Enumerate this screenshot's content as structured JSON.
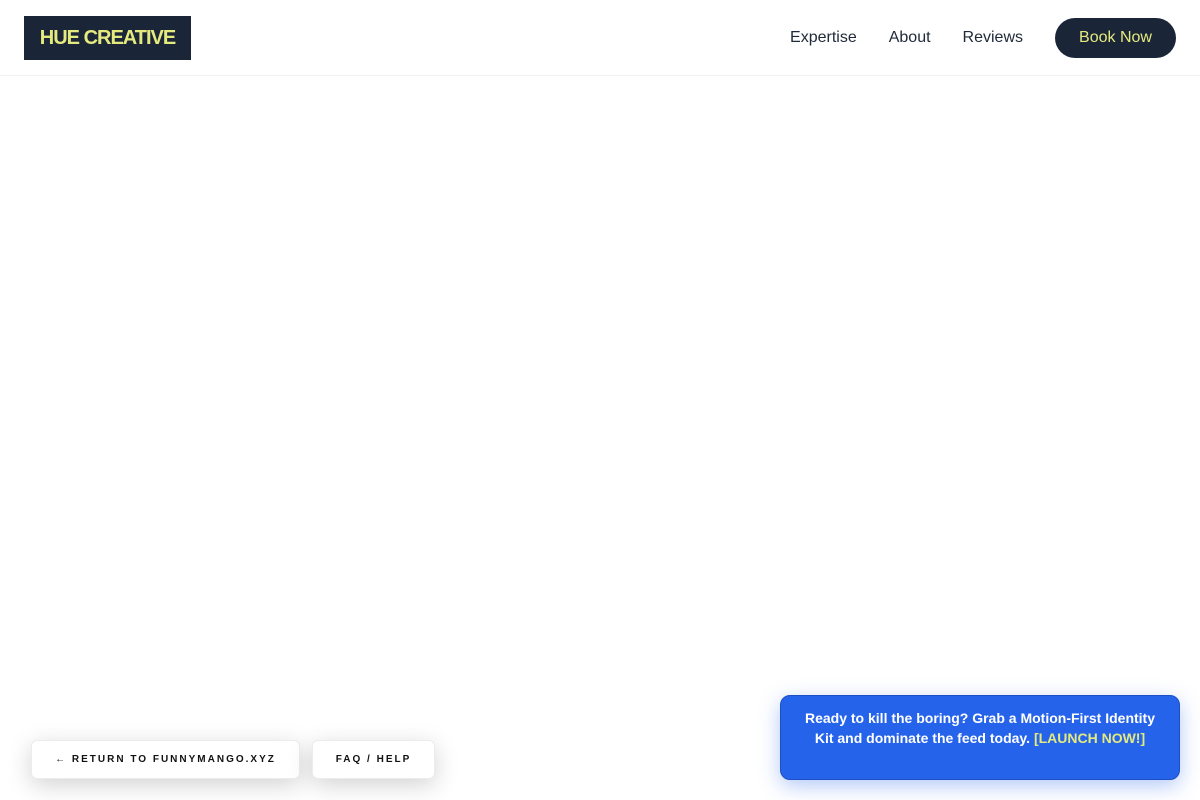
{
  "brand": {
    "logo_text": "HUE CREATIVE"
  },
  "nav": {
    "items": [
      {
        "label": "Expertise"
      },
      {
        "label": "About"
      },
      {
        "label": "Reviews"
      }
    ],
    "cta_label": "Book Now"
  },
  "footer_links": {
    "return_label": "← RETURN TO FUNNYMANGO.XYZ",
    "faq_label": "FAQ / HELP"
  },
  "promo": {
    "text": "Ready to kill the boring? Grab a Motion-First Identity Kit and dominate the feed today.",
    "link_text": "[LAUNCH NOW!]"
  },
  "colors": {
    "navy": "#1b2538",
    "accent_yellow": "#e4ea7e",
    "promo_blue": "#2563eb"
  }
}
